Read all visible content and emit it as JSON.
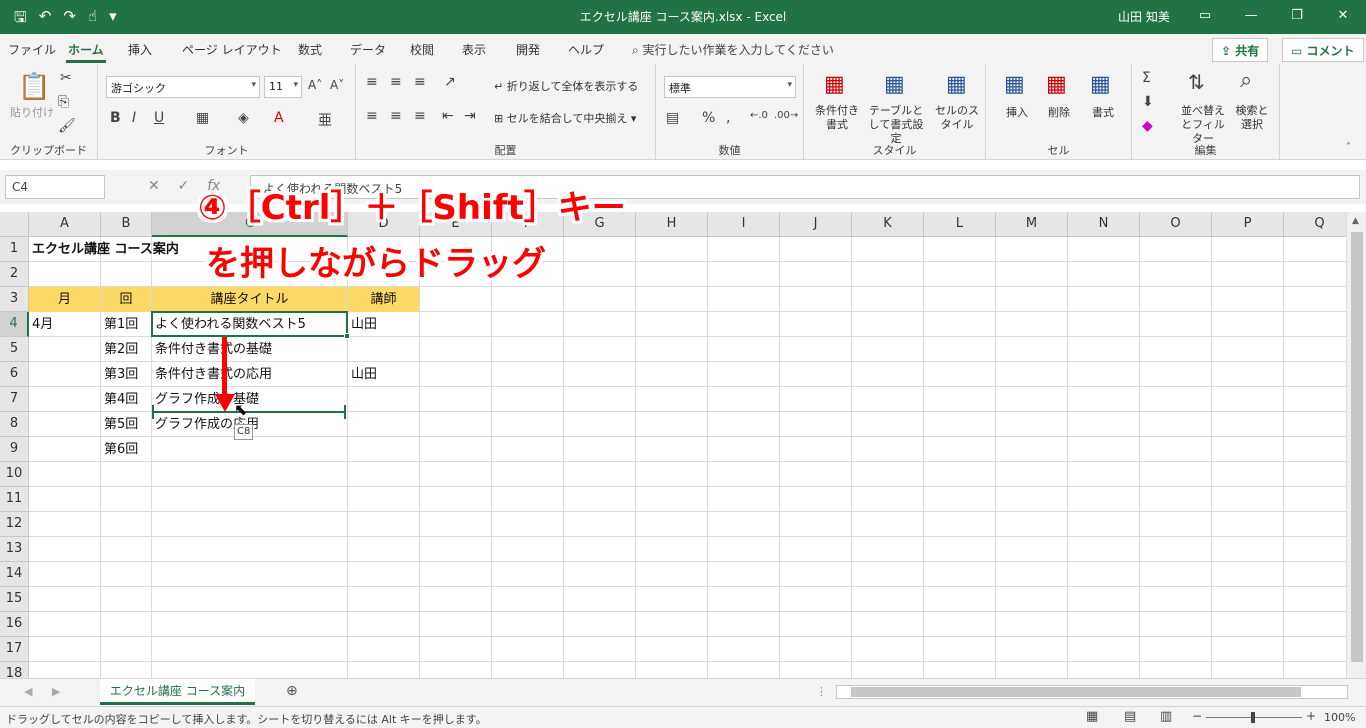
{
  "window": {
    "title": "エクセル講座 コース案内.xlsx  -  Excel",
    "user": "山田 知美"
  },
  "ribbon_tabs": [
    "ファイル",
    "ホーム",
    "挿入",
    "ページ レイアウト",
    "数式",
    "データ",
    "校閲",
    "表示",
    "開発",
    "ヘルプ"
  ],
  "tell_me": "実行したい作業を入力してください",
  "share_label": "共有",
  "comment_label": "コメント",
  "ribbon": {
    "clipboard": {
      "paste": "貼り付け",
      "label": "クリップボード"
    },
    "font": {
      "name": "游ゴシック",
      "size": "11",
      "label": "フォント"
    },
    "alignment": {
      "wrap": "折り返して全体を表示する",
      "merge": "セルを結合して中央揃え",
      "label": "配置"
    },
    "number": {
      "format": "標準",
      "label": "数値"
    },
    "styles": {
      "cond": "条件付き書式",
      "table": "テーブルとして書式設定",
      "cellstyle": "セルのスタイル",
      "label": "スタイル"
    },
    "cells": {
      "insert": "挿入",
      "delete": "削除",
      "format": "書式",
      "label": "セル"
    },
    "editing": {
      "sort": "並べ替えとフィルター",
      "find": "検索と選択",
      "label": "編集"
    }
  },
  "name_box": "C4",
  "formula": "よく使われる関数ベスト5",
  "columns": [
    "A",
    "B",
    "C",
    "D",
    "E",
    "F",
    "G",
    "H",
    "I",
    "J",
    "K",
    "L",
    "M",
    "N",
    "O",
    "P",
    "Q"
  ],
  "rows": [
    "1",
    "2",
    "3",
    "4",
    "5",
    "6",
    "7",
    "8",
    "9",
    "10",
    "11",
    "12",
    "13",
    "14",
    "15",
    "16",
    "17",
    "18"
  ],
  "sheet": {
    "title": "エクセル講座 コース案内",
    "headers": [
      "月",
      "回",
      "講座タイトル",
      "講師"
    ],
    "rows": [
      [
        "4月",
        "第1回",
        "よく使われる関数ベスト5",
        "山田"
      ],
      [
        "",
        "第2回",
        "条件付き書式の基礎",
        ""
      ],
      [
        "",
        "第3回",
        "条件付き書式の応用",
        "山田"
      ],
      [
        "",
        "第4回",
        "グラフ作成の基礎",
        ""
      ],
      [
        "",
        "第5回",
        "グラフ作成の応用",
        ""
      ],
      [
        "",
        "第6回",
        "",
        ""
      ]
    ]
  },
  "drag_tooltip": "C8",
  "annotation": {
    "line1": "④［Ctrl］＋［Shift］キー",
    "line2": "を押しながらドラッグ"
  },
  "sheet_tab": "エクセル講座 コース案内",
  "status_text": "ドラッグしてセルの内容をコピーして挿入します。シートを切り替えるには Alt キーを押します。",
  "zoom": "100%",
  "colors": {
    "accent": "#217346",
    "header_fill": "#FFD966",
    "annotation": "#FF0000"
  }
}
